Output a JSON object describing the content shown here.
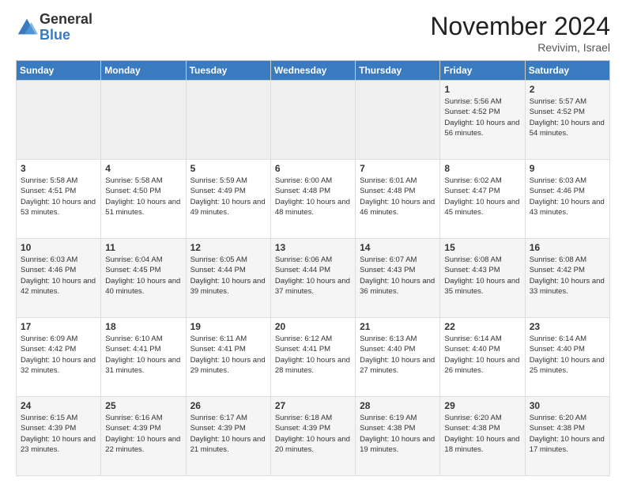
{
  "header": {
    "logo_general": "General",
    "logo_blue": "Blue",
    "month_title": "November 2024",
    "location": "Revivim, Israel"
  },
  "weekdays": [
    "Sunday",
    "Monday",
    "Tuesday",
    "Wednesday",
    "Thursday",
    "Friday",
    "Saturday"
  ],
  "weeks": [
    [
      {
        "day": "",
        "info": ""
      },
      {
        "day": "",
        "info": ""
      },
      {
        "day": "",
        "info": ""
      },
      {
        "day": "",
        "info": ""
      },
      {
        "day": "",
        "info": ""
      },
      {
        "day": "1",
        "info": "Sunrise: 5:56 AM\nSunset: 4:52 PM\nDaylight: 10 hours and 56 minutes."
      },
      {
        "day": "2",
        "info": "Sunrise: 5:57 AM\nSunset: 4:52 PM\nDaylight: 10 hours and 54 minutes."
      }
    ],
    [
      {
        "day": "3",
        "info": "Sunrise: 5:58 AM\nSunset: 4:51 PM\nDaylight: 10 hours and 53 minutes."
      },
      {
        "day": "4",
        "info": "Sunrise: 5:58 AM\nSunset: 4:50 PM\nDaylight: 10 hours and 51 minutes."
      },
      {
        "day": "5",
        "info": "Sunrise: 5:59 AM\nSunset: 4:49 PM\nDaylight: 10 hours and 49 minutes."
      },
      {
        "day": "6",
        "info": "Sunrise: 6:00 AM\nSunset: 4:48 PM\nDaylight: 10 hours and 48 minutes."
      },
      {
        "day": "7",
        "info": "Sunrise: 6:01 AM\nSunset: 4:48 PM\nDaylight: 10 hours and 46 minutes."
      },
      {
        "day": "8",
        "info": "Sunrise: 6:02 AM\nSunset: 4:47 PM\nDaylight: 10 hours and 45 minutes."
      },
      {
        "day": "9",
        "info": "Sunrise: 6:03 AM\nSunset: 4:46 PM\nDaylight: 10 hours and 43 minutes."
      }
    ],
    [
      {
        "day": "10",
        "info": "Sunrise: 6:03 AM\nSunset: 4:46 PM\nDaylight: 10 hours and 42 minutes."
      },
      {
        "day": "11",
        "info": "Sunrise: 6:04 AM\nSunset: 4:45 PM\nDaylight: 10 hours and 40 minutes."
      },
      {
        "day": "12",
        "info": "Sunrise: 6:05 AM\nSunset: 4:44 PM\nDaylight: 10 hours and 39 minutes."
      },
      {
        "day": "13",
        "info": "Sunrise: 6:06 AM\nSunset: 4:44 PM\nDaylight: 10 hours and 37 minutes."
      },
      {
        "day": "14",
        "info": "Sunrise: 6:07 AM\nSunset: 4:43 PM\nDaylight: 10 hours and 36 minutes."
      },
      {
        "day": "15",
        "info": "Sunrise: 6:08 AM\nSunset: 4:43 PM\nDaylight: 10 hours and 35 minutes."
      },
      {
        "day": "16",
        "info": "Sunrise: 6:08 AM\nSunset: 4:42 PM\nDaylight: 10 hours and 33 minutes."
      }
    ],
    [
      {
        "day": "17",
        "info": "Sunrise: 6:09 AM\nSunset: 4:42 PM\nDaylight: 10 hours and 32 minutes."
      },
      {
        "day": "18",
        "info": "Sunrise: 6:10 AM\nSunset: 4:41 PM\nDaylight: 10 hours and 31 minutes."
      },
      {
        "day": "19",
        "info": "Sunrise: 6:11 AM\nSunset: 4:41 PM\nDaylight: 10 hours and 29 minutes."
      },
      {
        "day": "20",
        "info": "Sunrise: 6:12 AM\nSunset: 4:41 PM\nDaylight: 10 hours and 28 minutes."
      },
      {
        "day": "21",
        "info": "Sunrise: 6:13 AM\nSunset: 4:40 PM\nDaylight: 10 hours and 27 minutes."
      },
      {
        "day": "22",
        "info": "Sunrise: 6:14 AM\nSunset: 4:40 PM\nDaylight: 10 hours and 26 minutes."
      },
      {
        "day": "23",
        "info": "Sunrise: 6:14 AM\nSunset: 4:40 PM\nDaylight: 10 hours and 25 minutes."
      }
    ],
    [
      {
        "day": "24",
        "info": "Sunrise: 6:15 AM\nSunset: 4:39 PM\nDaylight: 10 hours and 23 minutes."
      },
      {
        "day": "25",
        "info": "Sunrise: 6:16 AM\nSunset: 4:39 PM\nDaylight: 10 hours and 22 minutes."
      },
      {
        "day": "26",
        "info": "Sunrise: 6:17 AM\nSunset: 4:39 PM\nDaylight: 10 hours and 21 minutes."
      },
      {
        "day": "27",
        "info": "Sunrise: 6:18 AM\nSunset: 4:39 PM\nDaylight: 10 hours and 20 minutes."
      },
      {
        "day": "28",
        "info": "Sunrise: 6:19 AM\nSunset: 4:38 PM\nDaylight: 10 hours and 19 minutes."
      },
      {
        "day": "29",
        "info": "Sunrise: 6:20 AM\nSunset: 4:38 PM\nDaylight: 10 hours and 18 minutes."
      },
      {
        "day": "30",
        "info": "Sunrise: 6:20 AM\nSunset: 4:38 PM\nDaylight: 10 hours and 17 minutes."
      }
    ]
  ]
}
